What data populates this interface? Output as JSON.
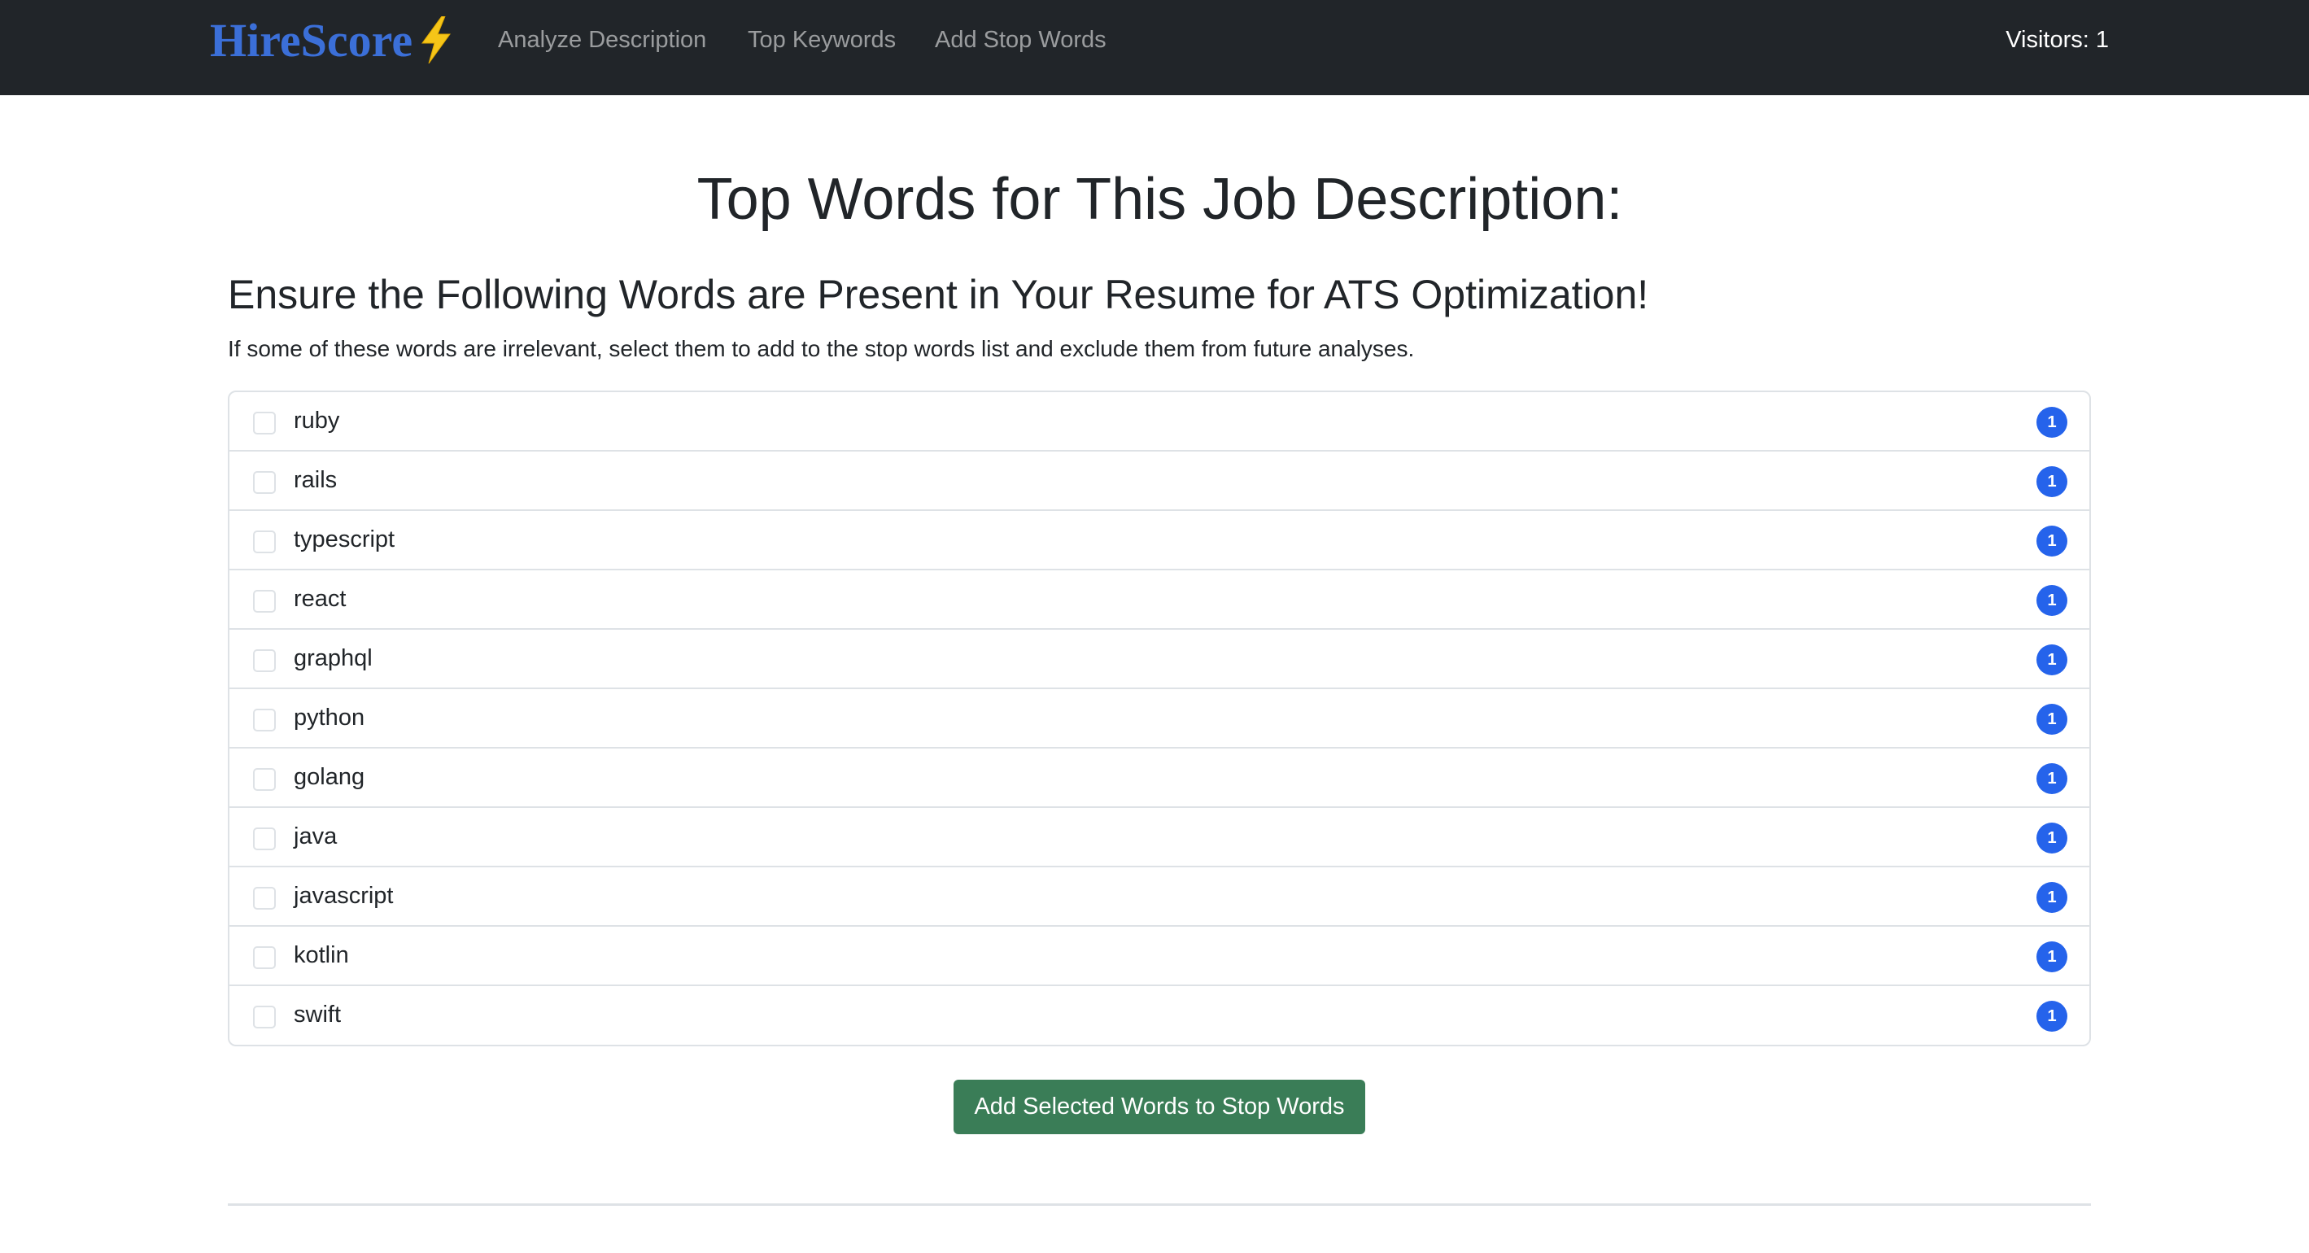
{
  "navbar": {
    "brand": "HireScore",
    "brand_icon": "lightning-bolt-icon",
    "links": [
      "Analyze Description",
      "Top Keywords",
      "Add Stop Words"
    ],
    "visitors": "Visitors: 1"
  },
  "main": {
    "title": "Top Words for This Job Description:",
    "subtitle": "Ensure the Following Words are Present in Your Resume for ATS Optimization!",
    "description": "If some of these words are irrelevant, select them to add to the stop words list and exclude them from future analyses.",
    "words": [
      {
        "word": "ruby",
        "count": "1",
        "checked": false
      },
      {
        "word": "rails",
        "count": "1",
        "checked": false
      },
      {
        "word": "typescript",
        "count": "1",
        "checked": false
      },
      {
        "word": "react",
        "count": "1",
        "checked": false
      },
      {
        "word": "graphql",
        "count": "1",
        "checked": false
      },
      {
        "word": "python",
        "count": "1",
        "checked": false
      },
      {
        "word": "golang",
        "count": "1",
        "checked": false
      },
      {
        "word": "java",
        "count": "1",
        "checked": false
      },
      {
        "word": "javascript",
        "count": "1",
        "checked": false
      },
      {
        "word": "kotlin",
        "count": "1",
        "checked": false
      },
      {
        "word": "swift",
        "count": "1",
        "checked": false
      }
    ],
    "submit_label": "Add Selected Words to Stop Words"
  },
  "colors": {
    "navbar_bg": "#212529",
    "brand": "#3b6fd8",
    "badge": "#2563eb",
    "button": "#3a7d57"
  }
}
